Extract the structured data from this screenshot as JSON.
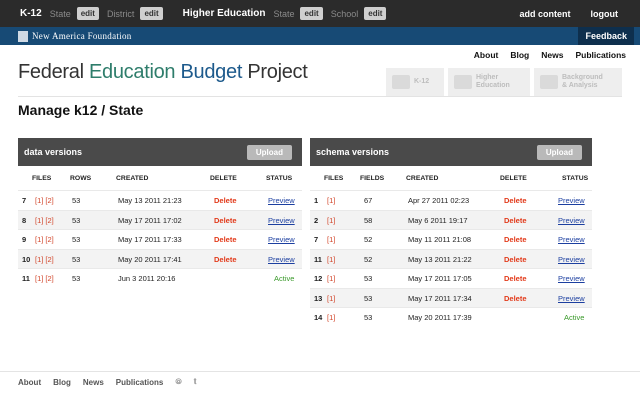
{
  "topbar": {
    "k12": "K-12",
    "state_label": "State",
    "edit1": "edit",
    "district_label": "District",
    "edit2": "edit",
    "higher_ed": "Higher Education",
    "state_label2": "State",
    "edit3": "edit",
    "school_label": "School",
    "edit4": "edit",
    "add_content": "add content",
    "logout": "logout"
  },
  "naf": {
    "name": "New America Foundation",
    "feedback": "Feedback"
  },
  "subnav": [
    "About",
    "Blog",
    "News",
    "Publications"
  ],
  "site_title": {
    "p1": "Federal ",
    "p2": "Education ",
    "p3": "Budget ",
    "p4": "Project"
  },
  "categories": [
    {
      "line1": "K-12",
      "line2": "",
      "icon": "apple-icon"
    },
    {
      "line1": "Higher",
      "line2": "Education",
      "icon": "mortarboard-icon"
    },
    {
      "line1": "Background",
      "line2": "& Analysis",
      "icon": "books-icon"
    }
  ],
  "page_heading": "Manage k12 / State",
  "data_versions": {
    "title": "data versions",
    "upload": "Upload",
    "headers": [
      "FILES",
      "ROWS",
      "CREATED",
      "DELETE",
      "STATUS"
    ],
    "rows": [
      {
        "id": "7",
        "files": "[1] [2]",
        "rows": "53",
        "created": "May 13 2011 21:23",
        "delete": "Delete",
        "status": "Preview"
      },
      {
        "id": "8",
        "files": "[1] [2]",
        "rows": "53",
        "created": "May 17 2011 17:02",
        "delete": "Delete",
        "status": "Preview"
      },
      {
        "id": "9",
        "files": "[1] [2]",
        "rows": "53",
        "created": "May 17 2011 17:33",
        "delete": "Delete",
        "status": "Preview"
      },
      {
        "id": "10",
        "files": "[1] [2]",
        "rows": "53",
        "created": "May 20 2011 17:41",
        "delete": "Delete",
        "status": "Preview"
      },
      {
        "id": "11",
        "files": "[1] [2]",
        "rows": "53",
        "created": "Jun 3 2011 20:16",
        "delete": "",
        "status": "Active"
      }
    ]
  },
  "schema_versions": {
    "title": "schema versions",
    "upload": "Upload",
    "headers": [
      "FILES",
      "FIELDS",
      "CREATED",
      "DELETE",
      "STATUS"
    ],
    "rows": [
      {
        "id": "1",
        "files": "[1]",
        "fields": "67",
        "created": "Apr 27 2011 02:23",
        "delete": "Delete",
        "status": "Preview"
      },
      {
        "id": "2",
        "files": "[1]",
        "fields": "58",
        "created": "May 6 2011 19:17",
        "delete": "Delete",
        "status": "Preview"
      },
      {
        "id": "7",
        "files": "[1]",
        "fields": "52",
        "created": "May 11 2011 21:08",
        "delete": "Delete",
        "status": "Preview"
      },
      {
        "id": "11",
        "files": "[1]",
        "fields": "52",
        "created": "May 13 2011 21:22",
        "delete": "Delete",
        "status": "Preview"
      },
      {
        "id": "12",
        "files": "[1]",
        "fields": "53",
        "created": "May 17 2011 17:05",
        "delete": "Delete",
        "status": "Preview"
      },
      {
        "id": "13",
        "files": "[1]",
        "fields": "53",
        "created": "May 17 2011 17:34",
        "delete": "Delete",
        "status": "Preview"
      },
      {
        "id": "14",
        "files": "[1]",
        "fields": "53",
        "created": "May 20 2011 17:39",
        "delete": "",
        "status": "Active"
      }
    ]
  },
  "footer": [
    "About",
    "Blog",
    "News",
    "Publications"
  ],
  "footer_icons": [
    "rss-icon",
    "twitter-icon"
  ],
  "colors": {
    "topbar": "#2b2b2b",
    "naf_bar": "#174a75",
    "delete": "#e23a1a",
    "active": "#3a9a2a",
    "link": "#1c3fa0"
  }
}
